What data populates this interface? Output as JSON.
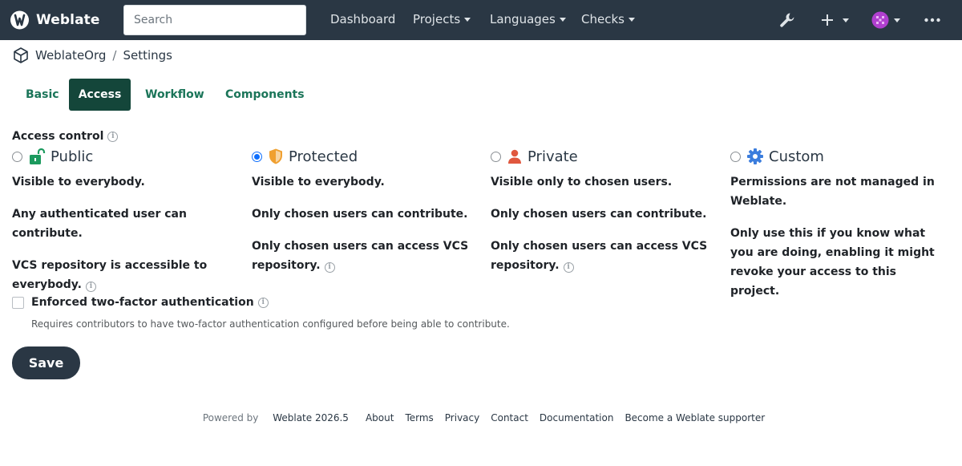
{
  "navbar": {
    "brand": "Weblate",
    "search_placeholder": "Search",
    "items": [
      "Dashboard",
      "Projects",
      "Languages",
      "Checks"
    ],
    "icons": [
      "wrench-icon",
      "plus-icon",
      "avatar",
      "more-icon"
    ]
  },
  "breadcrumb": {
    "project": "WeblateOrg",
    "page": "Settings"
  },
  "tabs": [
    "Basic",
    "Access",
    "Workflow",
    "Components"
  ],
  "active_tab": "Access",
  "access_control": {
    "label": "Access control",
    "options": [
      {
        "title": "Public",
        "icon": "unlock-icon",
        "selected": false,
        "lines": [
          "Visible to everybody.",
          "Any authenticated user can contribute.",
          "VCS repository is accessible to everybody."
        ]
      },
      {
        "title": "Protected",
        "icon": "shield-icon",
        "selected": true,
        "lines": [
          "Visible to everybody.",
          "Only chosen users can contribute.",
          "Only chosen users can access VCS repository."
        ]
      },
      {
        "title": "Private",
        "icon": "user-icon",
        "selected": false,
        "lines": [
          "Visible only to chosen users.",
          "Only chosen users can contribute.",
          "Only chosen users can access VCS repository."
        ]
      },
      {
        "title": "Custom",
        "icon": "gear-icon",
        "selected": false,
        "lines": [
          "Permissions are not managed in Weblate.",
          "Only use this if you know what you are doing, enabling it might revoke your access to this project."
        ]
      }
    ]
  },
  "two_factor": {
    "label": "Enforced two-factor authentication",
    "help": "Requires contributors to have two-factor authentication configured before being able to contribute.",
    "checked": false
  },
  "save_label": "Save",
  "footer": {
    "powered_by": "Powered by",
    "version": "Weblate 2026.5",
    "links": [
      "About",
      "Terms",
      "Privacy",
      "Contact",
      "Documentation",
      "Become a Weblate supporter"
    ]
  },
  "colors": {
    "navbar": "#2a3744",
    "tab_active": "#14463a",
    "tab_link": "#1b7559",
    "radio_selected": "#0d6efd",
    "public_icon": "#1b9a5e",
    "protected_icon": "#f0a030",
    "private_icon": "#e0573e",
    "custom_icon": "#3b7ddd"
  }
}
